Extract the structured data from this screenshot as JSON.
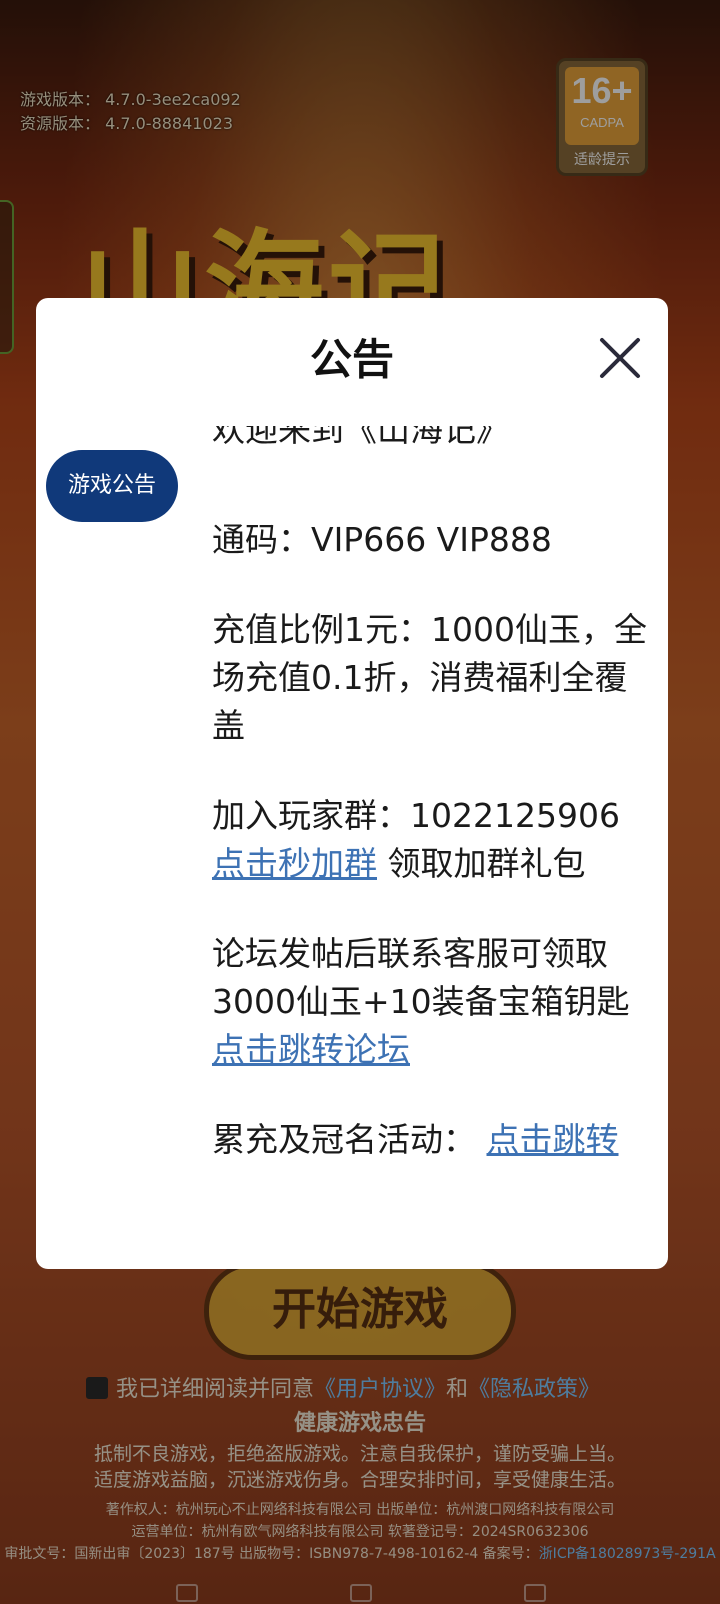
{
  "version": {
    "game_version": "游戏版本：  4.7.0-3ee2ca092",
    "resource_version": "资源版本：  4.7.0-88841023"
  },
  "age_badge": {
    "age": "16+",
    "org": "CADPA",
    "tip": "适龄提示"
  },
  "background": {
    "game_title": "山海记",
    "start_button": "开始游戏"
  },
  "agreement": {
    "text": "我已详细阅读并同意",
    "user_agreement": "《用户协议》",
    "and": "和",
    "privacy_policy": "《隐私政策》"
  },
  "health": {
    "title": "健康游戏忠告",
    "line1": "抵制不良游戏，拒绝盗版游戏。注意自我保护，谨防受骗上当。",
    "line2": "适度游戏益脑，沉迷游戏伤身。合理安排时间，享受健康生活。"
  },
  "footer": {
    "line1": "著作权人：杭州玩心不止网络科技有限公司  出版单位：杭州渡口网络科技有限公司",
    "line2": "运营单位：杭州有欧气网络科技有限公司  软著登记号：2024SR0632306",
    "line3_prefix": "审批文号：国新出审〔2023〕187号  出版物号：ISBN978-7-498-10162-4  备案号：",
    "icp": "浙ICP备18028973号-291A"
  },
  "modal": {
    "title": "公告",
    "tab_label": "游戏公告",
    "welcome": "欢迎来到《山海记》",
    "code_line": "通码：VIP666 VIP888",
    "recharge": "充值比例1元：1000仙玉，全场充值0.1折，消费福利全覆盖",
    "group_text": "加入玩家群：1022125906",
    "group_link": "点击秒加群",
    "group_suffix": " 领取加群礼包",
    "forum_text": "论坛发帖后联系客服可领取 3000仙玉+10装备宝箱钥匙 ",
    "forum_link": "点击跳转论坛",
    "event_text": "累充及冠名活动：  ",
    "event_link": "点击跳转"
  }
}
